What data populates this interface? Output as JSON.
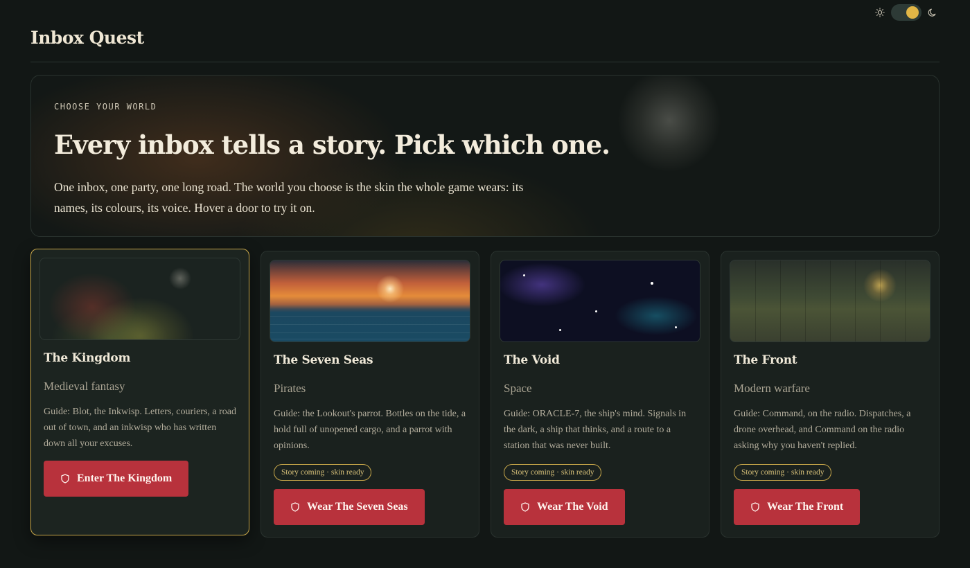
{
  "app": {
    "title": "Inbox Quest"
  },
  "theme_toggle": {
    "light_icon": "sun-icon",
    "dark_icon": "moon-icon",
    "state": "dark"
  },
  "hero": {
    "eyebrow": "CHOOSE YOUR WORLD",
    "title": "Every inbox tells a story. Pick which one.",
    "body": "One inbox, one party, one long road. The world you choose is the skin the whole game wears: its names, its colours, its voice. Hover a door to try it on."
  },
  "worlds": [
    {
      "name": "The Kingdom",
      "genre": "Medieval fantasy",
      "guide": "Guide: Blot, the Inkwisp. Letters, couriers, a road out of town, and an inkwisp who has written down all your excuses.",
      "badge": "",
      "button": "Enter The Kingdom",
      "selected": true
    },
    {
      "name": "The Seven Seas",
      "genre": "Pirates",
      "guide": "Guide: the Lookout's parrot. Bottles on the tide, a hold full of unopened cargo, and a parrot with opinions.",
      "badge": "Story coming · skin ready",
      "button": "Wear The Seven Seas",
      "selected": false
    },
    {
      "name": "The Void",
      "genre": "Space",
      "guide": "Guide: ORACLE-7, the ship's mind. Signals in the dark, a ship that thinks, and a route to a station that was never built.",
      "badge": "Story coming · skin ready",
      "button": "Wear The Void",
      "selected": false
    },
    {
      "name": "The Front",
      "genre": "Modern warfare",
      "guide": "Guide: Command, on the radio. Dispatches, a drone overhead, and Command on the radio asking why you haven't replied.",
      "badge": "Story coming · skin ready",
      "button": "Wear The Front",
      "selected": false
    }
  ],
  "colors": {
    "background": "#121715",
    "accent_gold": "#c9a84a",
    "button_red": "#b8323c"
  }
}
